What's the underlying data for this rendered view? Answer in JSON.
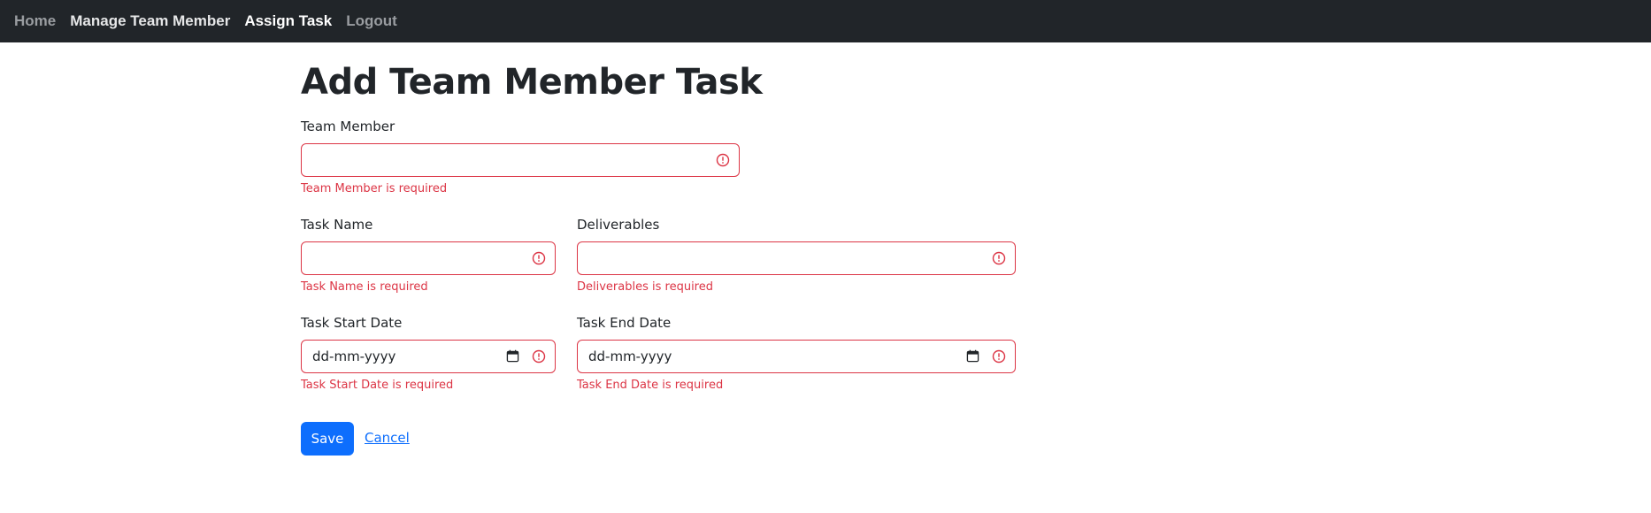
{
  "nav": {
    "items": [
      {
        "label": "Home"
      },
      {
        "label": "Manage Team Member"
      },
      {
        "label": "Assign Task"
      },
      {
        "label": "Logout"
      }
    ]
  },
  "page": {
    "title": "Add Team Member Task"
  },
  "form": {
    "team_member": {
      "label": "Team Member",
      "value": "",
      "error": "Team Member is required"
    },
    "task_name": {
      "label": "Task Name",
      "value": "",
      "error": "Task Name is required"
    },
    "deliverables": {
      "label": "Deliverables",
      "value": "",
      "error": "Deliverables is required"
    },
    "start_date": {
      "label": "Task Start Date",
      "placeholder": "dd-mm-yyyy",
      "error": "Task Start Date is required"
    },
    "end_date": {
      "label": "Task End Date",
      "placeholder": "dd-mm-yyyy",
      "error": "Task End Date is required"
    },
    "save_label": "Save",
    "cancel_label": "Cancel"
  },
  "colors": {
    "navbar_bg": "#212529",
    "invalid": "#dc3545",
    "primary": "#0d6efd"
  },
  "icons": {
    "invalid": "exclamation-circle-icon",
    "calendar": "calendar-icon"
  }
}
